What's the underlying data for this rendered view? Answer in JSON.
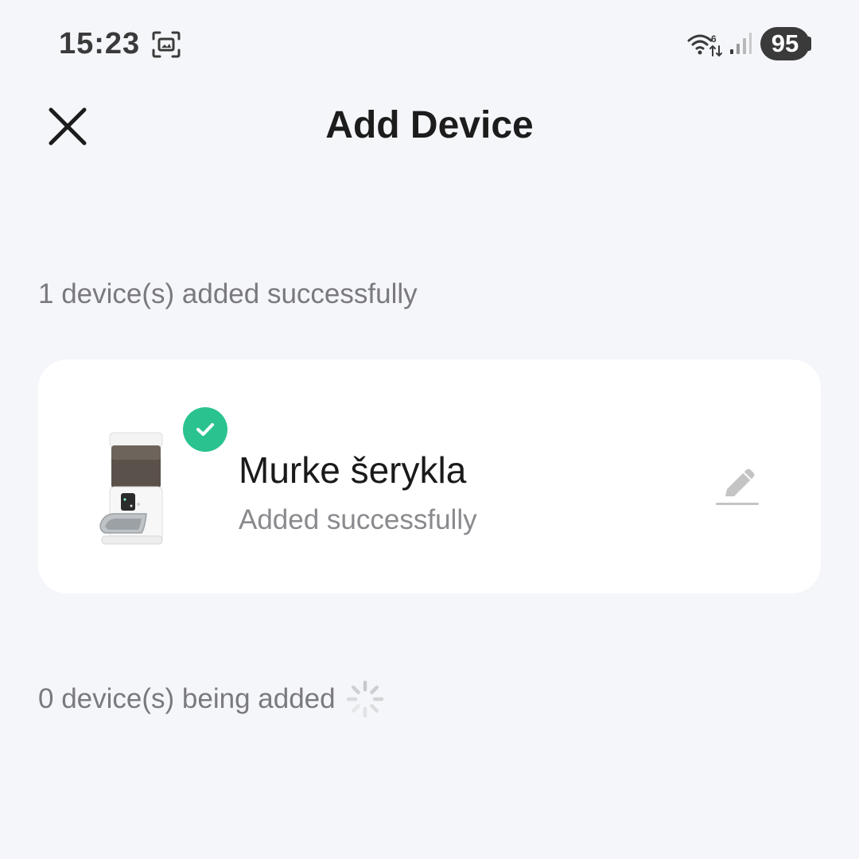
{
  "status_bar": {
    "time": "15:23",
    "battery": "95",
    "icons": [
      "screenshot-icon",
      "wifi-icon",
      "signal-icon"
    ]
  },
  "header": {
    "title": "Add Device",
    "close_icon": "close-icon"
  },
  "added_section": {
    "label": "1 device(s) added successfully",
    "devices": [
      {
        "name": "Murke šerykla",
        "status": "Added successfully",
        "status_icon": "check-circle-icon",
        "edit_icon": "pencil-icon"
      }
    ]
  },
  "adding_section": {
    "label": "0 device(s) being added",
    "icon": "loading-spinner-icon"
  },
  "colors": {
    "background": "#f5f6fa",
    "card": "#ffffff",
    "success": "#2ac38f",
    "muted_text": "#7a7a7e"
  }
}
